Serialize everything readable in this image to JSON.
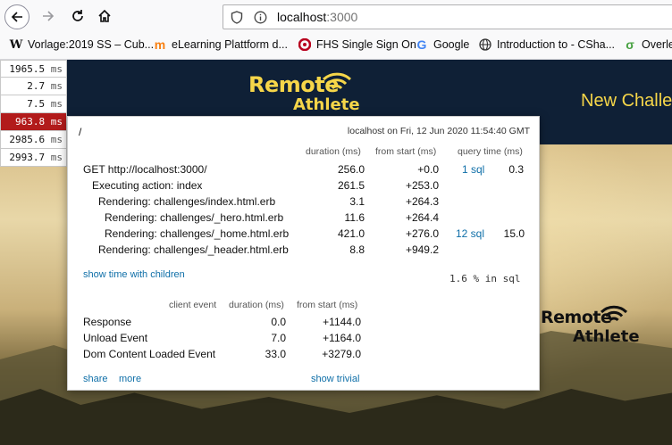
{
  "browser": {
    "url_host": "localhost",
    "url_port": ":3000",
    "bookmarks": [
      {
        "icon": "wikipedia-icon",
        "label": "Vorlage:2019 SS – Cub..."
      },
      {
        "icon": "moodle-icon",
        "label": "eLearning Plattform d..."
      },
      {
        "icon": "fhs-icon",
        "label": "FHS Single Sign On"
      },
      {
        "icon": "google-icon",
        "label": "Google"
      },
      {
        "icon": "globe-icon",
        "label": "Introduction to - CSha..."
      },
      {
        "icon": "overleaf-icon",
        "label": "Overlea"
      }
    ]
  },
  "site": {
    "logo_line1": "Remote",
    "logo_line2": "Athlete",
    "nav_text": "New Challe",
    "hero_logo_line1": "Remote",
    "hero_logo_line2": "Athlete",
    "accent_color": "#f6d649"
  },
  "profiler_badges": [
    {
      "value": "1965.5",
      "unit": "ms"
    },
    {
      "value": "2.7",
      "unit": "ms"
    },
    {
      "value": "7.5",
      "unit": "ms"
    },
    {
      "value": "963.8",
      "unit": "ms",
      "highlight": true
    },
    {
      "value": "2985.6",
      "unit": "ms"
    },
    {
      "value": "2993.7",
      "unit": "ms"
    }
  ],
  "profiler": {
    "path": "/",
    "timestamp": "localhost on Fri, 12 Jun 2020 11:54:40 GMT",
    "headers": {
      "duration": "duration (ms)",
      "from_start": "from start (ms)",
      "query_time": "query time (ms)"
    },
    "rows": [
      {
        "name": "GET http://localhost:3000/",
        "duration": "256.0",
        "from_start": "+0.0",
        "sql": "1 sql",
        "query_time": "0.3"
      },
      {
        "name": "Executing action: index",
        "duration": "261.5",
        "from_start": "+253.0",
        "sql": "",
        "query_time": ""
      },
      {
        "name": "Rendering: challenges/index.html.erb",
        "duration": "3.1",
        "from_start": "+264.3",
        "sql": "",
        "query_time": ""
      },
      {
        "name": "Rendering: challenges/_hero.html.erb",
        "duration": "11.6",
        "from_start": "+264.4",
        "sql": "",
        "query_time": ""
      },
      {
        "name": "Rendering: challenges/_home.html.erb",
        "duration": "421.0",
        "from_start": "+276.0",
        "sql": "12 sql",
        "query_time": "15.0"
      },
      {
        "name": "Rendering: challenges/_header.html.erb",
        "duration": "8.8",
        "from_start": "+949.2",
        "sql": "",
        "query_time": ""
      }
    ],
    "show_children": "show time with children",
    "sql_percent": "1.6 % in sql",
    "client_headers": {
      "event": "client event",
      "duration": "duration (ms)",
      "from_start": "from start (ms)"
    },
    "client_rows": [
      {
        "name": "Response",
        "duration": "0.0",
        "from_start": "+1144.0"
      },
      {
        "name": "Unload Event",
        "duration": "7.0",
        "from_start": "+1164.0"
      },
      {
        "name": "Dom Content Loaded Event",
        "duration": "33.0",
        "from_start": "+3279.0"
      }
    ],
    "share": "share",
    "more": "more",
    "show_trivial": "show trivial"
  }
}
